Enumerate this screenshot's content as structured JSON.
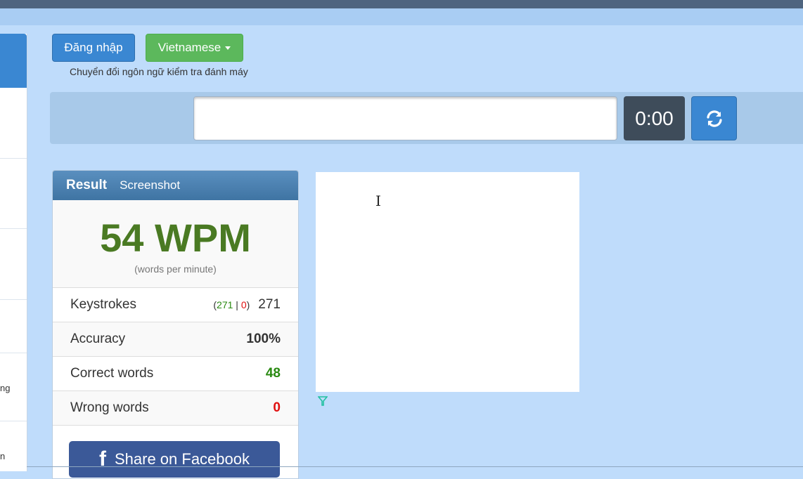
{
  "header": {
    "login_label": "Đăng nhập",
    "language_label": "Vietnamese",
    "language_hint": "Chuyển đổi ngôn ngữ kiểm tra đánh máy"
  },
  "typing": {
    "input_value": "",
    "timer": "0:00",
    "reload_icon": "refresh-icon"
  },
  "left_panel": {
    "fragments": [
      "ng",
      "n"
    ]
  },
  "result": {
    "tabs": [
      "Result",
      "Screenshot"
    ],
    "wpm": "54 WPM",
    "wpm_caption": "(words per minute)",
    "keystrokes_label": "Keystrokes",
    "keystrokes_correct": "271",
    "keystrokes_sep": "|",
    "keystrokes_wrong": "0",
    "keystrokes_total": "271",
    "accuracy_label": "Accuracy",
    "accuracy_value": "100%",
    "correct_words_label": "Correct words",
    "correct_words_value": "48",
    "wrong_words_label": "Wrong words",
    "wrong_words_value": "0",
    "share_label": "Share on Facebook",
    "share_icon": "facebook-icon"
  },
  "colors": {
    "accent_blue": "#3a87d2",
    "success_green": "#5cb85c",
    "wpm_green": "#4a7a23",
    "error_red": "#e01010",
    "facebook_blue": "#3b5998"
  }
}
